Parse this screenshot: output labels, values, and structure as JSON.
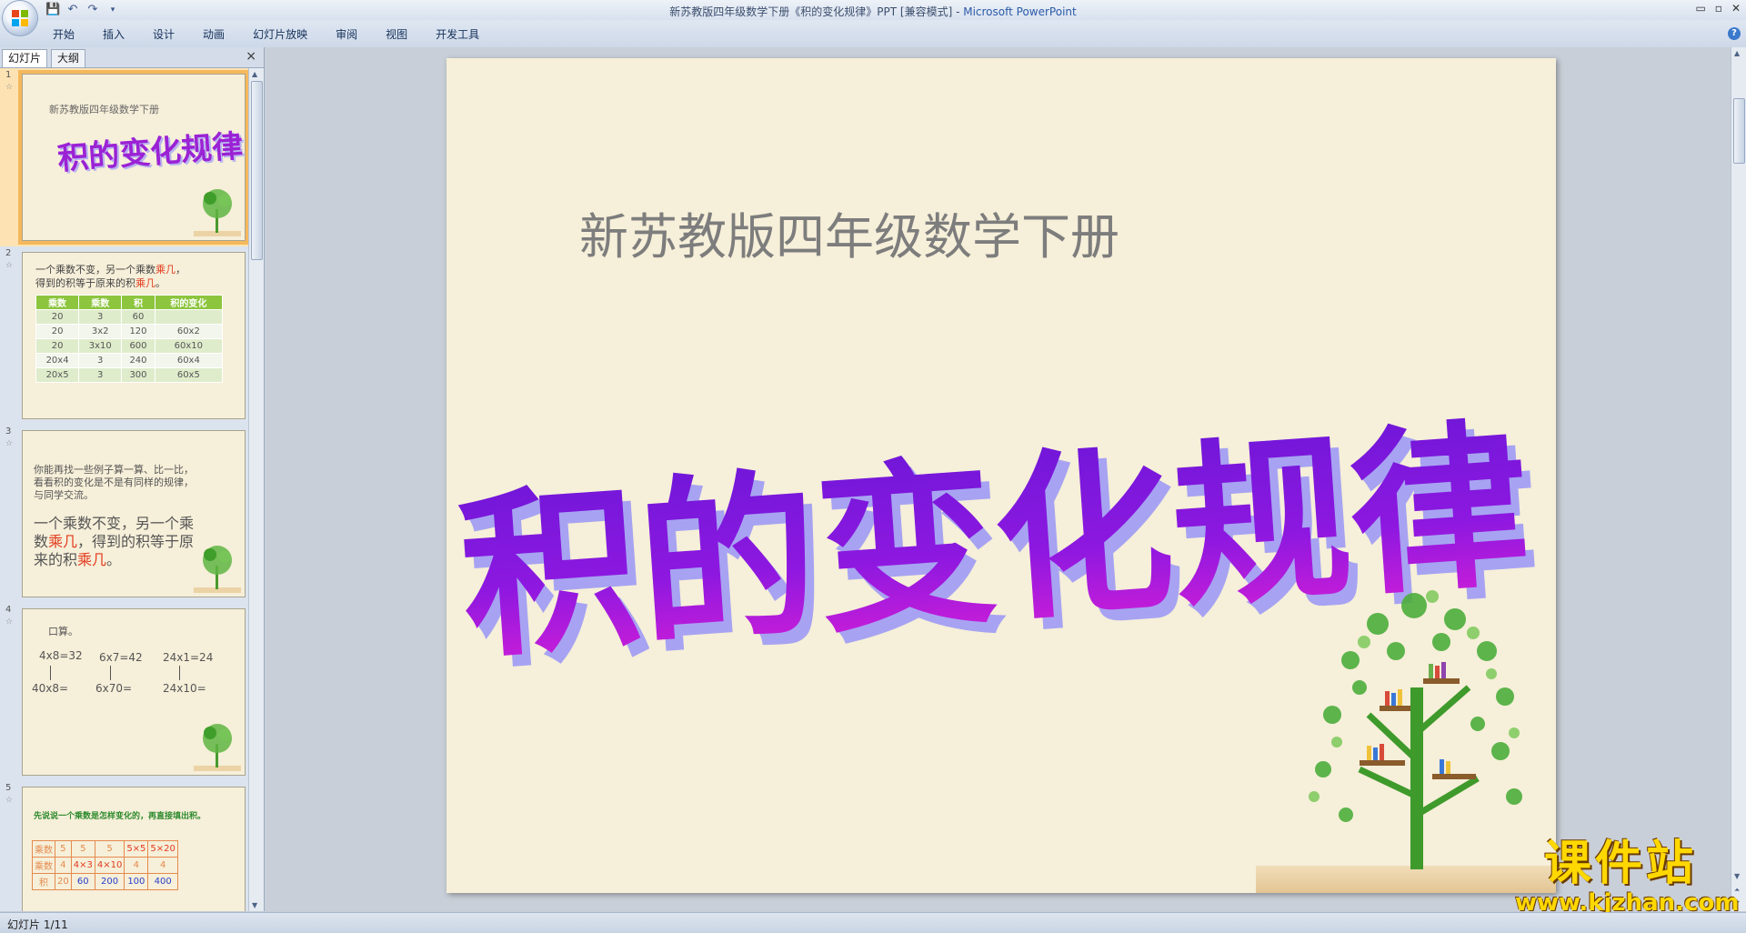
{
  "window": {
    "title": "新苏教版四年级数学下册《积的变化规律》PPT [兼容模式] - ",
    "app": "Microsoft PowerPoint",
    "controls": [
      "▭",
      "▫",
      "✕"
    ]
  },
  "qat": [
    "save-icon",
    "undo-icon",
    "redo-icon",
    "customize-icon"
  ],
  "ribbon": {
    "tabs": [
      "开始",
      "插入",
      "设计",
      "动画",
      "幻灯片放映",
      "审阅",
      "视图",
      "开发工具"
    ]
  },
  "pane": {
    "tabs": [
      "幻灯片",
      "大纲"
    ],
    "close": "×"
  },
  "thumbs": [
    {
      "num": "1",
      "subtitle": "新苏教版四年级数学下册",
      "title": "积的变化规律"
    },
    {
      "num": "2",
      "line1a": "一个乘数不变，另一个乘数",
      "line1b": "乘几",
      "line1c": "，",
      "line2a": "得到的积等于原来的积",
      "line2b": "乘几",
      "line2c": "。",
      "table": {
        "headers": [
          "乘数",
          "乘数",
          "积",
          "积的变化"
        ],
        "rows": [
          [
            "20",
            "3",
            "60",
            ""
          ],
          [
            "20",
            "3x2",
            "120",
            "60x2"
          ],
          [
            "20",
            "3x10",
            "600",
            "60x10"
          ],
          [
            "20x4",
            "3",
            "240",
            "60x4"
          ],
          [
            "20x5",
            "3",
            "300",
            "60x5"
          ]
        ]
      }
    },
    {
      "num": "3",
      "l1": "你能再找一些例子算一算、比一比，",
      "l2": "看看积的变化是不是有同样的规律，",
      "l3": "与同学交流。",
      "b1": "一个乘数不变，另一个乘",
      "b2a": "数",
      "b2b": "乘几",
      "b2c": "，得到的积等于原",
      "b3a": "来的积",
      "b3b": "乘几",
      "b3c": "。"
    },
    {
      "num": "4",
      "head": "口算。",
      "e1": "4x8=32",
      "e2": "6x7=42",
      "e3": "24x1=24",
      "f1": "40x8=",
      "f2": "6x70=",
      "f3": "24x10="
    },
    {
      "num": "5",
      "head": "先说说一个乘数是怎样变化的，再直接填出积。",
      "table": {
        "rows": [
          [
            "乘数",
            "5",
            "5",
            "5",
            "5×5",
            "5×20"
          ],
          [
            "乘数",
            "4",
            "4×3",
            "4×10",
            "4",
            "4"
          ],
          [
            "积",
            "20",
            "60",
            "200",
            "100",
            "400"
          ]
        ]
      }
    }
  ],
  "slide": {
    "subtitle": "新苏教版四年级数学下册",
    "title": "积的变化规律"
  },
  "watermark": {
    "cn": "课件站",
    "url": "www.kjzhan.com"
  },
  "status": {
    "text": "幻灯片 1/11"
  },
  "colors": {
    "accent_title_top": "#7b1fe0",
    "accent_title_bottom": "#c21ad6",
    "shadow": "#a7a3f2",
    "red": "#e23b1e",
    "green_header": "#8dc53f"
  }
}
